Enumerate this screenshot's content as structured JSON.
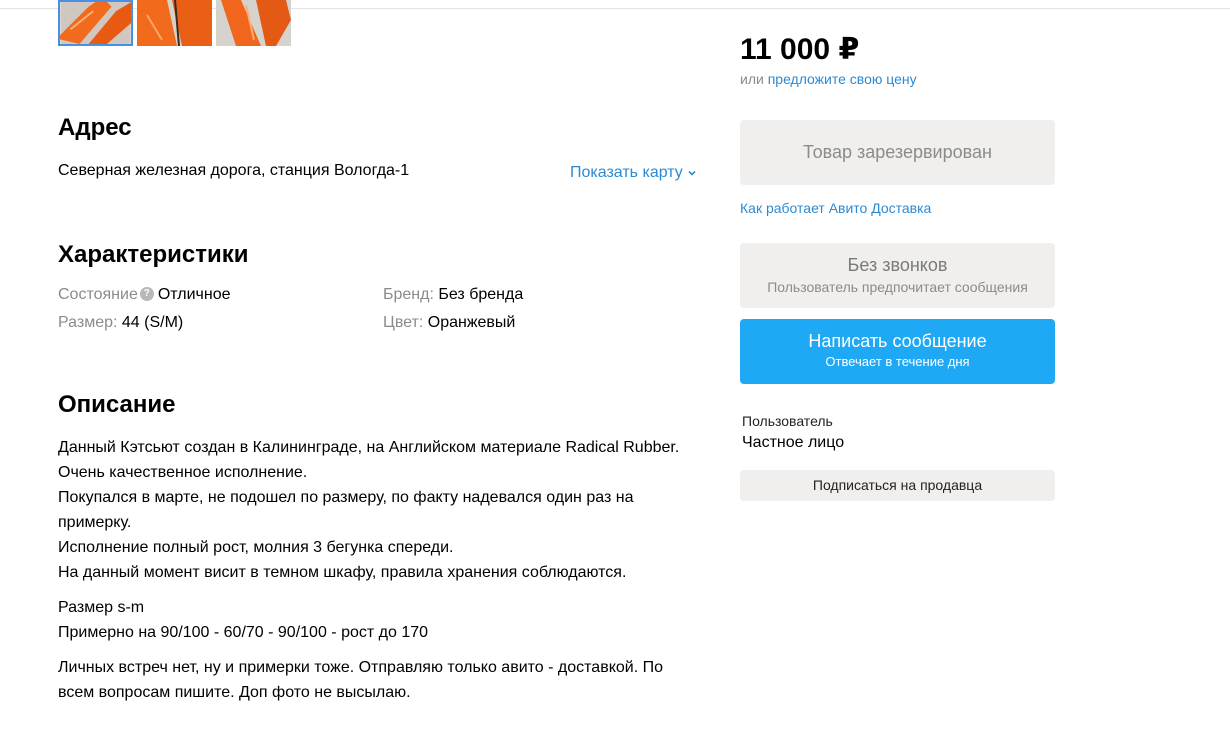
{
  "gallery": {
    "thumbnails": 3
  },
  "address": {
    "heading": "Адрес",
    "text": "Северная железная дорога, станция Вологда-1",
    "show_map": "Показать карту"
  },
  "characteristics": {
    "heading": "Характеристики",
    "condition_label": "Состояние",
    "condition_value": "Отличное",
    "size_label": "Размер:",
    "size_value": "44 (S/M)",
    "brand_label": "Бренд:",
    "brand_value": "Без бренда",
    "color_label": "Цвет:",
    "color_value": "Оранжевый"
  },
  "description": {
    "heading": "Описание",
    "p1": [
      "Данный Кэтсьют создан в Калининграде, на Английском материале Radical Rubber.",
      "Очень качественное исполнение.",
      "Покупался в марте, не подошел по размеру, по факту надевался один раз на примерку.",
      "Исполнение полный рост, молния 3 бегунка спереди.",
      "На данный момент висит в темном шкафу, правила хранения соблюдаются."
    ],
    "p2": [
      "Размер s-m",
      "Примерно на 90/100 - 60/70 - 90/100 - рост до 170"
    ],
    "p3": "Личных встреч нет, ну и примерки тоже. Отправляю только авито - доставкой. По всем вопросам пишите. Доп фото не высылаю."
  },
  "sidebar": {
    "price": "11 000 ₽",
    "offer_prefix": "или ",
    "offer_link": "предложите свою цену",
    "reserved_button": "Товар зарезервирован",
    "delivery_link": "Как работает Авито Доставка",
    "no_calls_title": "Без звонков",
    "no_calls_sub": "Пользователь предпочитает сообщения",
    "write_title": "Написать сообщение",
    "write_sub": "Отвечает в течение дня",
    "user_label": "Пользователь",
    "user_type": "Частное лицо",
    "subscribe_button": "Подписаться на продавца"
  },
  "colors": {
    "accent_blue": "#1fa9f4",
    "link_blue": "#2c8ad3",
    "muted_gray": "#8b8b8b",
    "button_gray": "#f0efed",
    "product_orange": "#f26a1b"
  }
}
